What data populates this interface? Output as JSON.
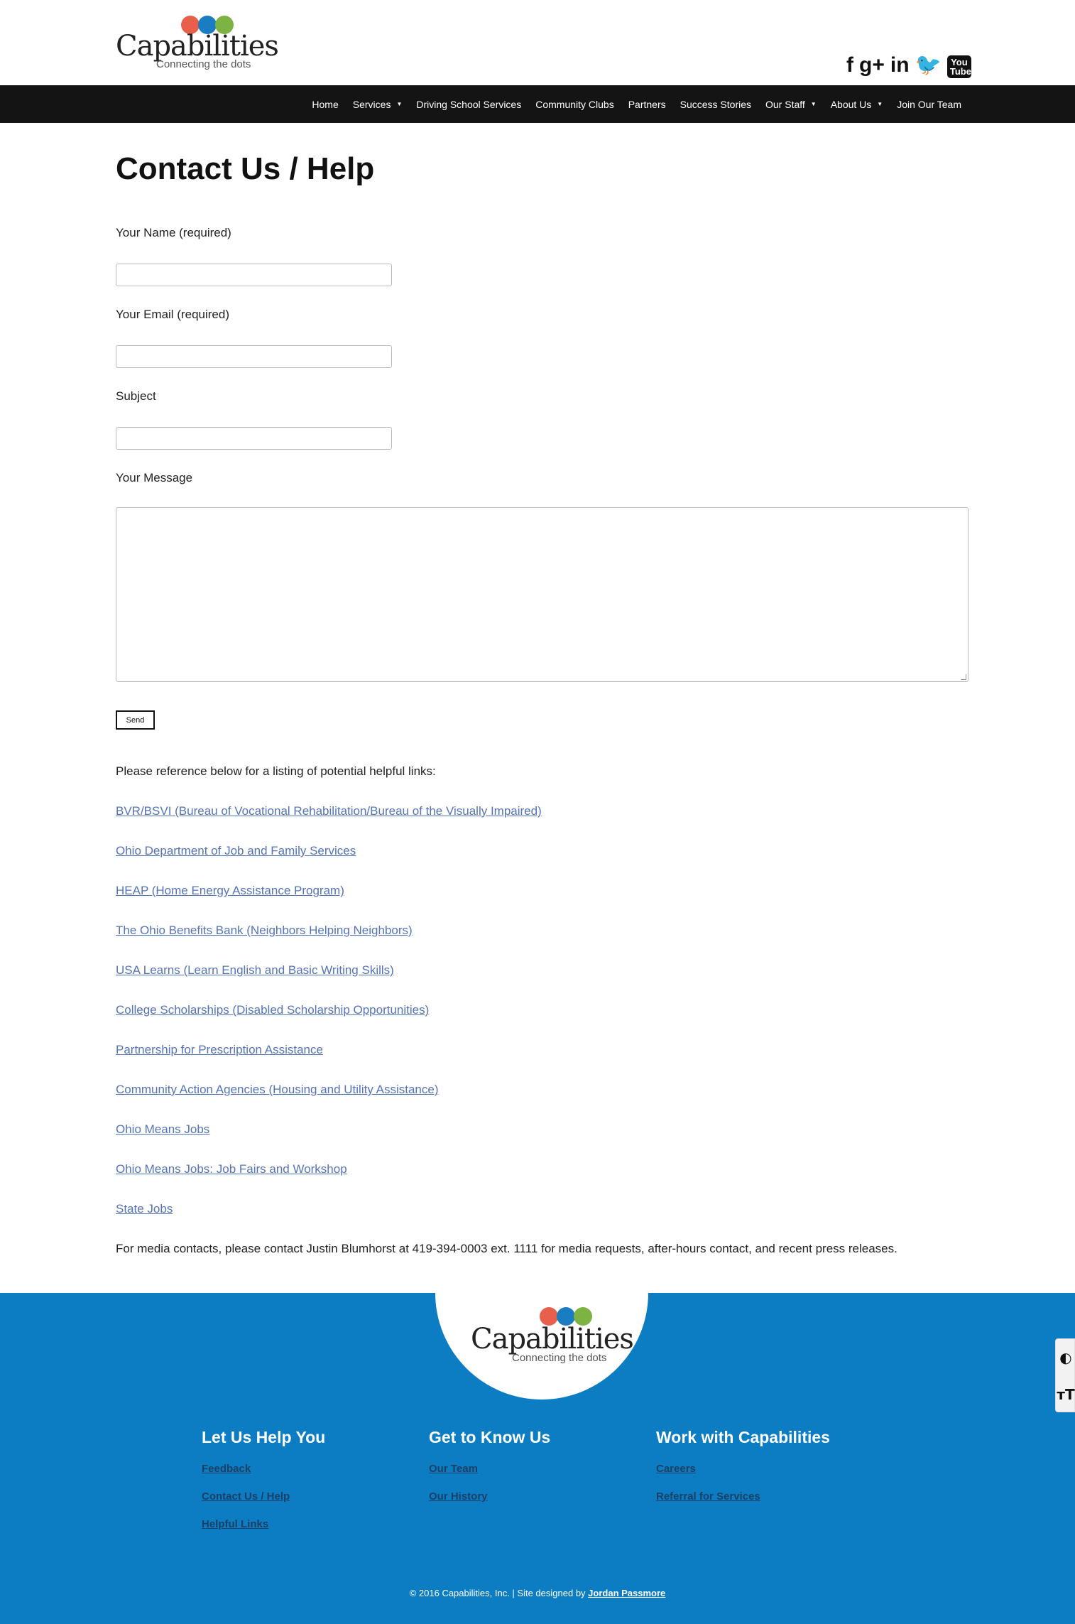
{
  "header": {
    "logo_word": "Capabilities",
    "logo_tagline": "Connecting the dots",
    "social": [
      {
        "icon": "facebook-icon",
        "glyph": "f"
      },
      {
        "icon": "google-plus-icon",
        "glyph": "g+"
      },
      {
        "icon": "linkedin-icon",
        "glyph": "in"
      },
      {
        "icon": "twitter-icon",
        "glyph": "🐦"
      },
      {
        "icon": "youtube-icon",
        "glyph": "You Tube"
      }
    ]
  },
  "nav": {
    "items": [
      {
        "label": "Home",
        "dropdown": false
      },
      {
        "label": "Services",
        "dropdown": true
      },
      {
        "label": "Driving School Services",
        "dropdown": false
      },
      {
        "label": "Community Clubs",
        "dropdown": false
      },
      {
        "label": "Partners",
        "dropdown": false
      },
      {
        "label": "Success Stories",
        "dropdown": false
      },
      {
        "label": "Our Staff",
        "dropdown": true
      },
      {
        "label": "About Us",
        "dropdown": true
      },
      {
        "label": "Join Our Team",
        "dropdown": false
      }
    ]
  },
  "page": {
    "title": "Contact Us / Help",
    "form": {
      "name_label": "Your  Name (required)",
      "email_label": "Your  Email (required)",
      "subject_label": "Subject",
      "message_label": "Your  Message",
      "name_value": "",
      "email_value": "",
      "subject_value": "",
      "message_value": "",
      "send_label": "Send"
    },
    "links_intro": "Please reference below for a listing of potential helpful links:",
    "links": [
      "BVR/BSVI (Bureau of Vocational  Rehabilitation/Bureau of the Visually  Impaired)",
      "Ohio  Department of Job and  Family Services",
      "HEAP (Home  Energy Assistance  Program)",
      "The Ohio  Benefits  Bank (Neighbors  Helping  Neighbors)",
      "USA  Learns (Learn  English and  Basic Writing Skills)",
      "College Scholarships (Disabled Scholarship Opportunities)",
      "Partnership for  Prescription Assistance",
      "Community Action Agencies (Housing and Utility Assistance)",
      "Ohio  Means Jobs",
      "Ohio  Means Jobs:  Job  Fairs and Workshop",
      "State Jobs"
    ],
    "media_note": "For media contacts, please contact Justin  Blumhorst at 419-394-0003 ext. 1111 for media requests, after-hours contact, and recent press releases."
  },
  "footer": {
    "logo_word": "Capabilities",
    "logo_tagline": "Connecting the dots",
    "columns": [
      {
        "title": "Let Us Help You",
        "links": [
          "Feedback",
          "Contact Us / Help",
          "Helpful Links"
        ]
      },
      {
        "title": "Get to Know Us",
        "links": [
          "Our Team",
          "Our History"
        ]
      },
      {
        "title": "Work with Capabilities",
        "links": [
          "Careers",
          "Referral for Services"
        ]
      }
    ],
    "copyright": "© 2016 Capabilities,  Inc.  | Site designed by",
    "designer": "Jordan Passmore"
  },
  "a11y": {
    "contrast_icon": "contrast-icon",
    "contrast_glyph": "◐",
    "font_size_icon": "font-size-icon",
    "font_size_glyph": "тT"
  },
  "colors": {
    "nav_bg": "#141414",
    "footer_bg": "#0c7dc2",
    "link": "#5574b8",
    "dot_red": "#e8604c",
    "dot_blue": "#1a7cc1",
    "dot_green": "#7cb342"
  }
}
